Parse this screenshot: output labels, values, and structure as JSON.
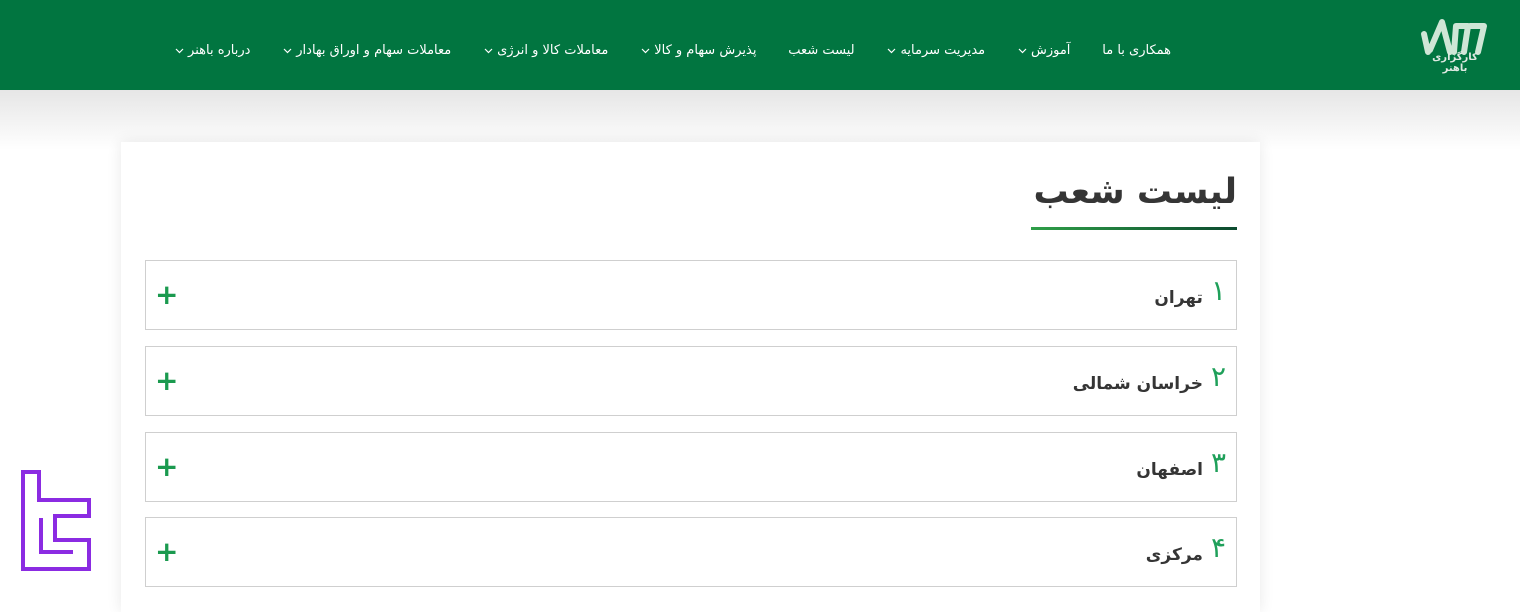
{
  "header": {
    "bg_color": "#017540",
    "logo_text": "کارگزاری باهنر",
    "logo_icon": "bahonar-logo-icon",
    "nav": [
      {
        "label": "درباره باهنر",
        "has_dropdown": true
      },
      {
        "label": "معاملات سهام و اوراق بهادار",
        "has_dropdown": true
      },
      {
        "label": "معاملات کالا و انرژی",
        "has_dropdown": true
      },
      {
        "label": "پذیرش سهام و کالا",
        "has_dropdown": true
      },
      {
        "label": "لیست شعب",
        "has_dropdown": false
      },
      {
        "label": "مدیریت سرمایه",
        "has_dropdown": true
      },
      {
        "label": "آموزش",
        "has_dropdown": true
      },
      {
        "label": "همکاری با ما",
        "has_dropdown": false
      }
    ]
  },
  "main": {
    "title": "لیست شعب",
    "accent_color": "#1fa05a",
    "branches": [
      {
        "number": "۱",
        "name": "تهران"
      },
      {
        "number": "۲",
        "name": "خراسان شمالی"
      },
      {
        "number": "۳",
        "name": "اصفهان"
      },
      {
        "number": "۴",
        "name": "مرکزی"
      }
    ],
    "expand_icon": "plus-icon"
  },
  "side_badge": {
    "icon": "purple-brand-icon",
    "color": "#8b2be2"
  }
}
